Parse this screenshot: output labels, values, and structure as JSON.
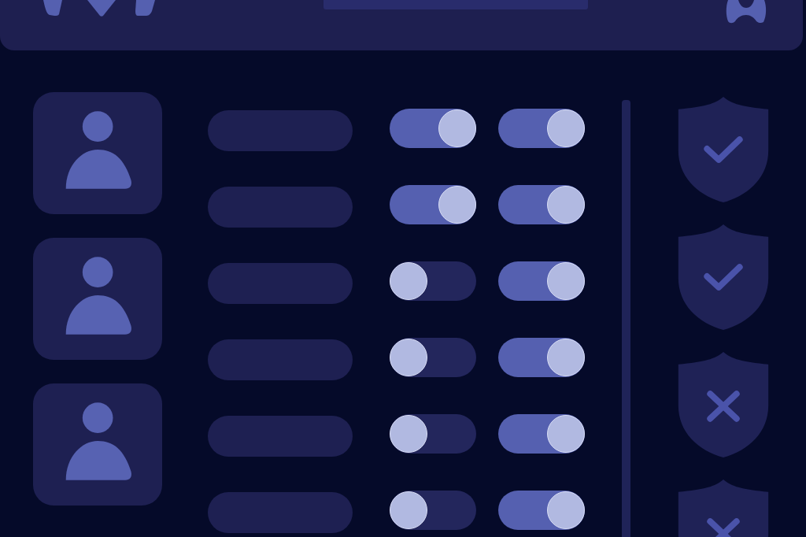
{
  "profile_cards": [
    {
      "kind": "person"
    },
    {
      "kind": "person"
    },
    {
      "kind": "person"
    }
  ],
  "rows": [
    {
      "toggles": [
        {
          "on": true
        },
        {
          "on": true
        }
      ]
    },
    {
      "toggles": [
        {
          "on": true
        },
        {
          "on": true
        }
      ]
    },
    {
      "toggles": [
        {
          "on": false
        },
        {
          "on": true
        }
      ]
    },
    {
      "toggles": [
        {
          "on": false
        },
        {
          "on": true
        }
      ]
    },
    {
      "toggles": [
        {
          "on": false
        },
        {
          "on": true
        }
      ]
    },
    {
      "toggles": [
        {
          "on": false
        },
        {
          "on": true
        }
      ]
    }
  ],
  "shields": [
    {
      "kind": "check"
    },
    {
      "kind": "check"
    },
    {
      "kind": "cross"
    },
    {
      "kind": "cross"
    }
  ]
}
